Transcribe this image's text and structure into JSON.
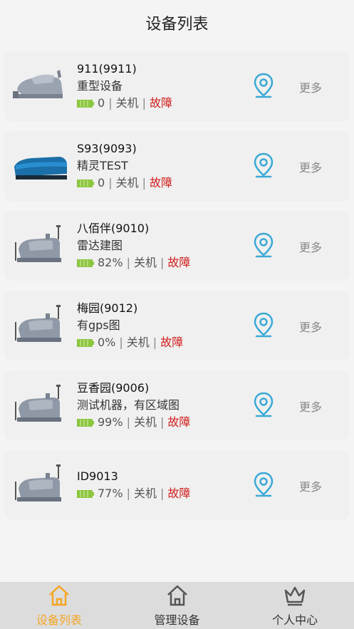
{
  "header": {
    "title": "设备列表"
  },
  "devices": [
    {
      "name": "911(9911)",
      "type": "重型设备",
      "battery": "0",
      "power": "关机",
      "fault": "故障",
      "more": "更多",
      "image": "heavy-robot-icon"
    },
    {
      "name": "S93(9093)",
      "type": "精灵TEST",
      "battery": "0",
      "power": "关机",
      "fault": "故障",
      "more": "更多",
      "image": "blue-robot-icon"
    },
    {
      "name": "八佰伴(9010)",
      "type": "雷达建图",
      "battery": "82%",
      "power": "关机",
      "fault": "故障",
      "more": "更多",
      "image": "radar-robot-icon"
    },
    {
      "name": "梅园(9012)",
      "type": "有gps图",
      "battery": "0%",
      "power": "关机",
      "fault": "故障",
      "more": "更多",
      "image": "radar-robot-icon"
    },
    {
      "name": "豆香园(9006)",
      "type": "测试机器，有区域图",
      "battery": "99%",
      "power": "关机",
      "fault": "故障",
      "more": "更多",
      "image": "radar-robot-icon"
    },
    {
      "name": "ID9013",
      "type": "",
      "battery": "77%",
      "power": "关机",
      "fault": "故障",
      "more": "更多",
      "image": "radar-robot-icon"
    }
  ],
  "tabbar": {
    "tabs": [
      {
        "label": "设备列表",
        "icon": "home-icon",
        "active": true
      },
      {
        "label": "管理设备",
        "icon": "home-icon",
        "active": false
      },
      {
        "label": "个人中心",
        "icon": "crown-icon",
        "active": false
      }
    ]
  },
  "colors": {
    "accent": "#f5a623",
    "fault": "#d0201e",
    "location": "#3aa9d6",
    "battery": "#8cc63f"
  }
}
